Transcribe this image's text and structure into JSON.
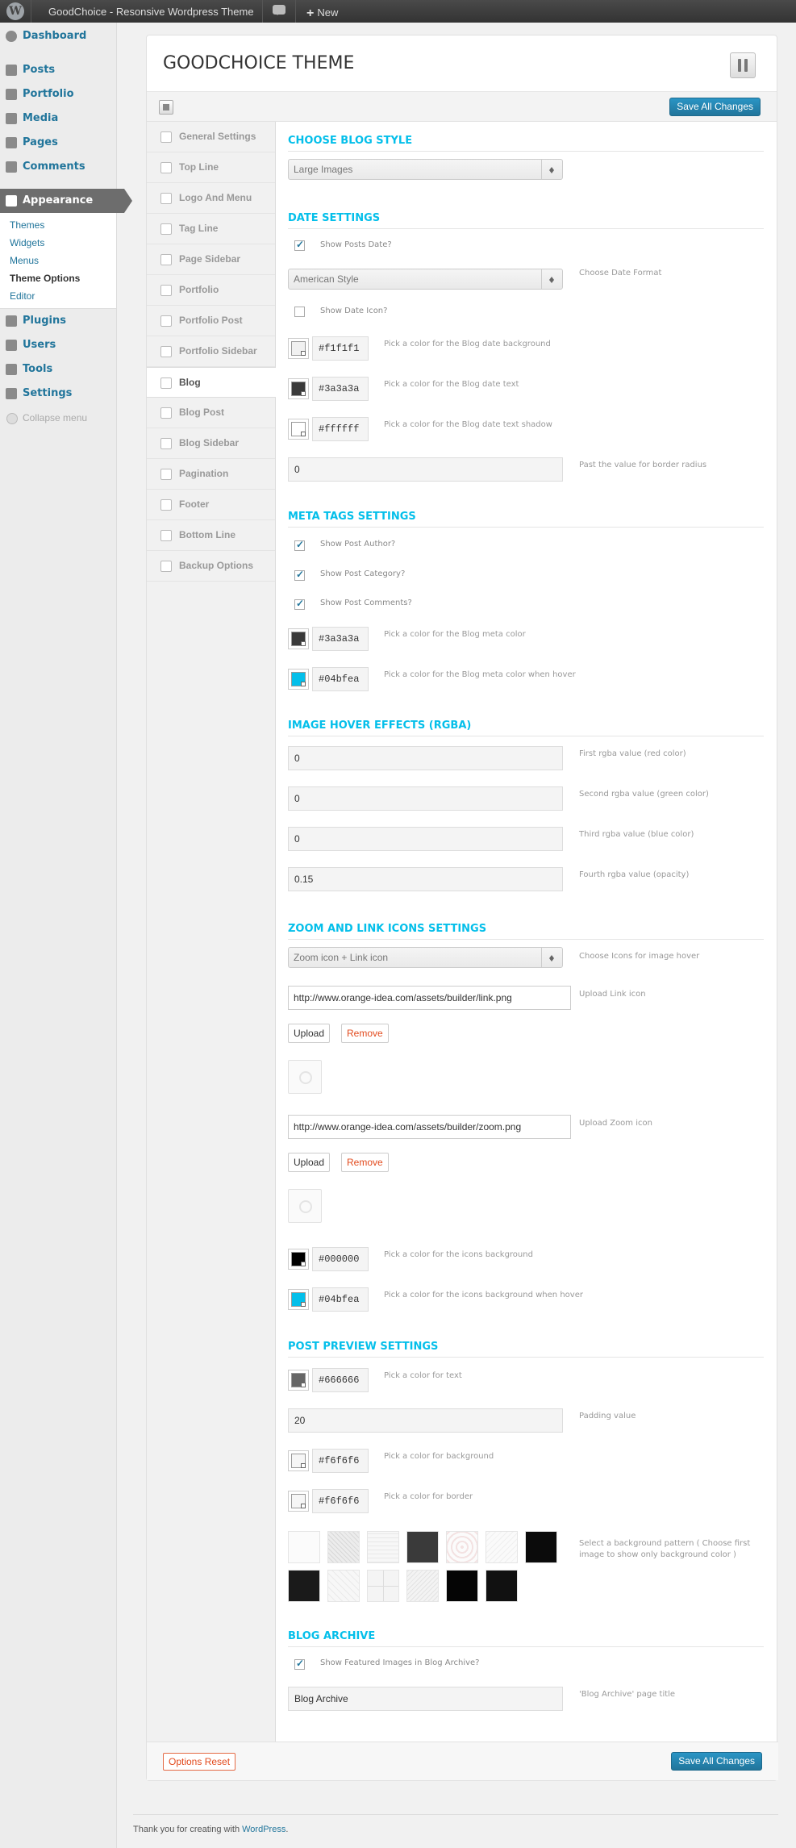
{
  "adminbar": {
    "site_name": "GoodChoice - Resonsive Wordpress Theme",
    "new_label": "New"
  },
  "menu": {
    "items": [
      {
        "label": "Dashboard"
      },
      {
        "label": "Posts"
      },
      {
        "label": "Portfolio"
      },
      {
        "label": "Media"
      },
      {
        "label": "Pages"
      },
      {
        "label": "Comments"
      },
      {
        "label": "Appearance"
      },
      {
        "label": "Plugins"
      },
      {
        "label": "Users"
      },
      {
        "label": "Tools"
      },
      {
        "label": "Settings"
      }
    ],
    "submenu": [
      "Themes",
      "Widgets",
      "Menus",
      "Theme Options",
      "Editor"
    ],
    "collapse": "Collapse menu"
  },
  "header": {
    "title": "GOODCHOICE THEME"
  },
  "save_label": "Save All Changes",
  "reset_label": "Options Reset",
  "nav": [
    "General Settings",
    "Top Line",
    "Logo And Menu",
    "Tag Line",
    "Page Sidebar",
    "Portfolio",
    "Portfolio Post",
    "Portfolio Sidebar",
    "Blog",
    "Blog Post",
    "Blog Sidebar",
    "Pagination",
    "Footer",
    "Bottom Line",
    "Backup Options"
  ],
  "blog_style": {
    "title": "CHOOSE BLOG STYLE",
    "select": "Large Images"
  },
  "date": {
    "title": "DATE SETTINGS",
    "show_date": "Show Posts Date?",
    "format_select": "American Style",
    "format_desc": "Choose Date Format",
    "show_icon": "Show Date Icon?",
    "bg_color": "#f1f1f1",
    "bg_desc": "Pick a color for the Blog date background",
    "text_color": "#3a3a3a",
    "text_desc": "Pick a color for the Blog date text",
    "shadow_color": "#ffffff",
    "shadow_desc": "Pick a color for the Blog date text shadow",
    "radius": "0",
    "radius_desc": "Past the value for border radius"
  },
  "meta": {
    "title": "META TAGS SETTINGS",
    "author": "Show Post Author?",
    "category": "Show Post Category?",
    "comments": "Show Post Comments?",
    "color": "#3a3a3a",
    "color_desc": "Pick a color for the Blog meta color",
    "hover": "#04bfea",
    "hover_desc": "Pick a color for the Blog meta color when hover"
  },
  "hover": {
    "title": "IMAGE HOVER EFFECTS (RGBA)",
    "r": "0",
    "r_desc": "First rgba value (red color)",
    "g": "0",
    "g_desc": "Second rgba value (green color)",
    "b": "0",
    "b_desc": "Third rgba value (blue color)",
    "a": "0.15",
    "a_desc": "Fourth rgba value (opacity)"
  },
  "icons": {
    "title": "ZOOM AND LINK ICONS SETTINGS",
    "select": "Zoom icon + Link icon",
    "select_desc": "Choose Icons for image hover",
    "link_url": "http://www.orange-idea.com/assets/builder/link.png",
    "link_desc": "Upload Link icon",
    "zoom_url": "http://www.orange-idea.com/assets/builder/zoom.png",
    "zoom_desc": "Upload Zoom icon",
    "upload": "Upload",
    "remove": "Remove",
    "bg": "#000000",
    "bg_desc": "Pick a color for the icons background",
    "bg_hover": "#04bfea",
    "bg_hover_desc": "Pick a color for the icons background when hover"
  },
  "preview": {
    "title": "POST PREVIEW SETTINGS",
    "text_color": "#666666",
    "text_desc": "Pick a color for text",
    "padding": "20",
    "padding_desc": "Padding value",
    "bg": "#f6f6f6",
    "bg_desc": "Pick a color for background",
    "border": "#f6f6f6",
    "border_desc": "Pick a color for border",
    "pattern_desc": "Select a background pattern ( Choose first image to show only background color )"
  },
  "archive": {
    "title": "BLOG ARCHIVE",
    "show_featured": "Show Featured Images in Blog Archive?",
    "page_title": "Blog Archive",
    "page_title_desc": "'Blog Archive' page title"
  },
  "footer": {
    "text": "Thank you for creating with ",
    "link": "WordPress",
    "end": "."
  }
}
